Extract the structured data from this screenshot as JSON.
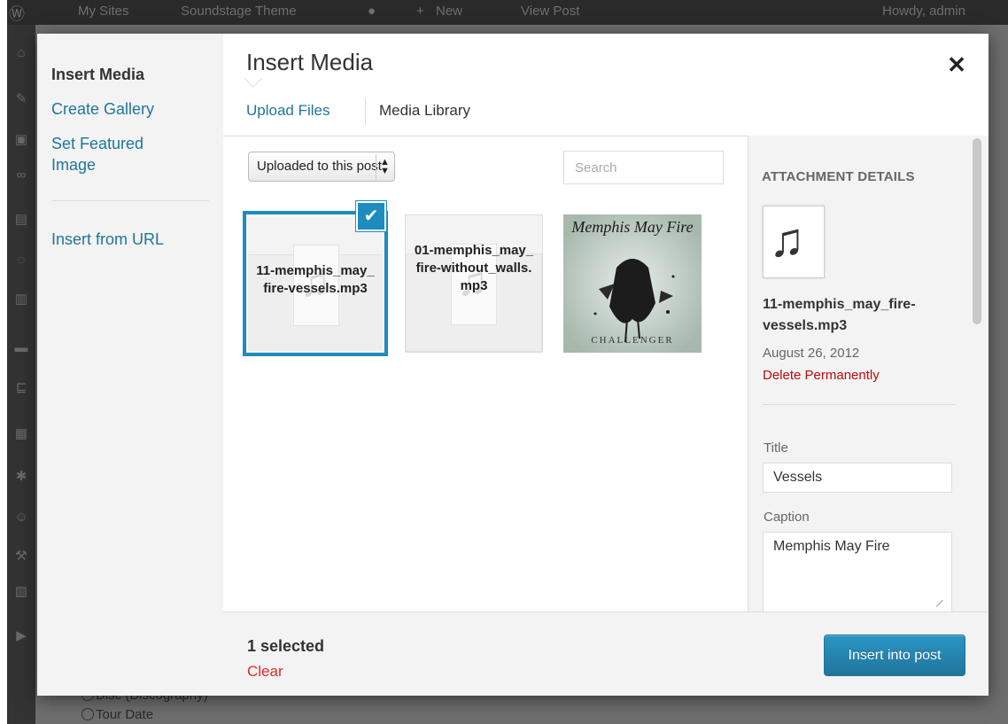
{
  "admin_bar": {
    "my_sites": "My Sites",
    "site_name": "Soundstage Theme",
    "new": "New",
    "view_post": "View Post",
    "howdy": "Howdy, admin"
  },
  "background": {
    "discography_label": "Disc (Discography)",
    "tour_date_label": "Tour Date"
  },
  "modal": {
    "menu": {
      "items": [
        {
          "label": "Insert Media"
        },
        {
          "label": "Create Gallery"
        },
        {
          "label": "Set Featured Image"
        },
        {
          "label": "Insert from URL"
        }
      ]
    },
    "frame_title": "Insert Media",
    "close_symbol": "✕",
    "tabs": [
      {
        "label": "Upload Files"
      },
      {
        "label": "Media Library"
      }
    ],
    "filter": {
      "selected": "Uploaded to this post"
    },
    "search": {
      "placeholder": "Search"
    },
    "attachments": [
      {
        "filename": "11-memphis_may_fire-vessels.mp3",
        "selected": true
      },
      {
        "filename": "01-memphis_may_fire-without_walls.mp3",
        "selected": false
      },
      {
        "album_text_top": "Memphis May Fire",
        "album_text_bottom": "CHALLENGER"
      }
    ],
    "details": {
      "heading": "ATTACHMENT DETAILS",
      "filename": "11-memphis_may_fire-vessels.mp3",
      "date": "August 26, 2012",
      "delete_label": "Delete Permanently",
      "title_label": "Title",
      "title_value": "Vessels",
      "caption_label": "Caption",
      "caption_value": "Memphis May Fire"
    },
    "toolbar": {
      "selected_count": "1 selected",
      "clear_label": "Clear",
      "insert_label": "Insert into post"
    }
  },
  "colors": {
    "accent": "#21759b",
    "selection": "#1e8cbe",
    "delete": "#bc0b0b",
    "clear": "#e02a2a"
  }
}
